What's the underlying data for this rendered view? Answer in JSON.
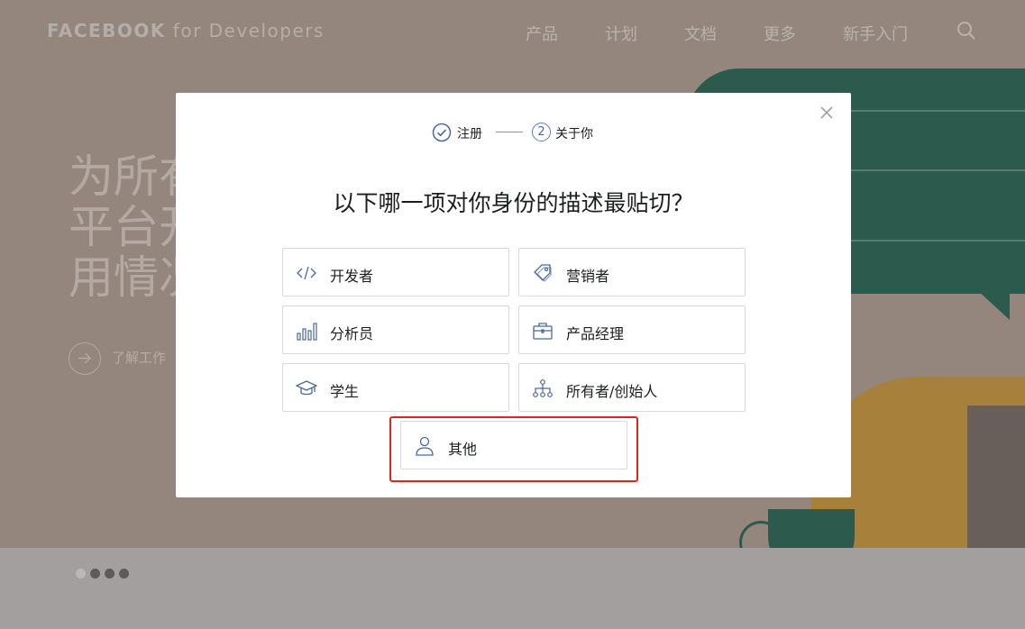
{
  "header": {
    "brand_bold": "FACEBOOK",
    "brand_rest": " for Developers",
    "nav": [
      {
        "label": "产品"
      },
      {
        "label": "计划"
      },
      {
        "label": "文档"
      },
      {
        "label": "更多"
      },
      {
        "label": "新手入门"
      }
    ],
    "search_icon": "search-icon"
  },
  "hero": {
    "line1": "为所有",
    "line2": "平台开",
    "line3": "用情况",
    "learn_more": "了解工作"
  },
  "carousel": {
    "count": 4,
    "active_index": 0
  },
  "modal": {
    "close_icon": "close-icon",
    "steps": {
      "step1": "注册",
      "step2_number": "2",
      "step2": "关于你"
    },
    "question": "以下哪一项对你身份的描述最贴切？",
    "options": [
      {
        "label": "开发者",
        "icon": "code-icon"
      },
      {
        "label": "营销者",
        "icon": "tag-icon"
      },
      {
        "label": "分析员",
        "icon": "bar-chart-icon"
      },
      {
        "label": "产品经理",
        "icon": "briefcase-icon"
      },
      {
        "label": "学生",
        "icon": "graduation-cap-icon"
      },
      {
        "label": "所有者/创始人",
        "icon": "hierarchy-icon"
      },
      {
        "label": "其他",
        "icon": "person-icon"
      }
    ]
  },
  "colors": {
    "accent": "#4b67a1",
    "highlight": "#e5241b",
    "modal_bg": "#ffffff"
  }
}
